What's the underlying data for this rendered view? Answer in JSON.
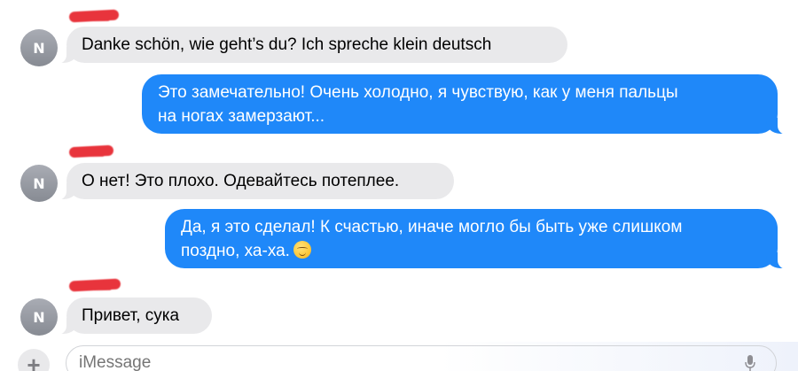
{
  "contact": {
    "initial": "N"
  },
  "messages": [
    {
      "direction": "incoming",
      "text": "Danke schön, wie geht’s du? Ich spreche klein deutsch"
    },
    {
      "direction": "outgoing",
      "lines": [
        "Это замечательно!  Очень холодно, я чувствую, как у меня пальцы",
        "на ногах замерзают..."
      ]
    },
    {
      "direction": "incoming",
      "text": "О нет! Это плохо. Одевайтесь потеплее."
    },
    {
      "direction": "outgoing",
      "lines": [
        "Да, я это сделал! К счастью, иначе могло бы быть уже слишком",
        "поздно, ха-ха."
      ],
      "emoji": "smiling-face-icon"
    },
    {
      "direction": "incoming",
      "text": "Привет, сука"
    }
  ],
  "composer": {
    "placeholder": "iMessage",
    "plus_icon": "+"
  },
  "colors": {
    "outgoing": "#1f88f9",
    "incoming": "#e9e9eb",
    "redaction": "#e8343c"
  }
}
